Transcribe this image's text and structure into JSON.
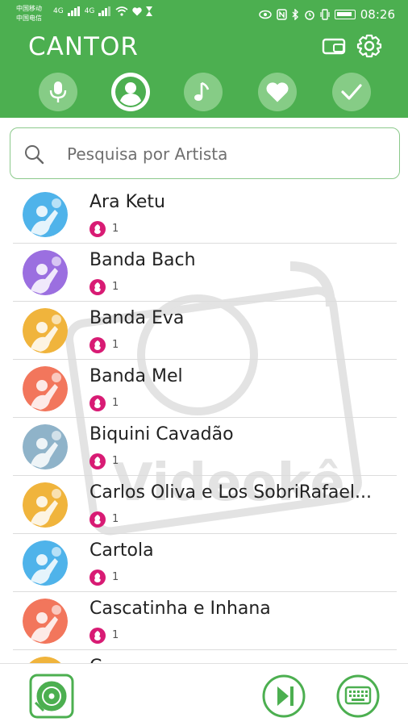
{
  "status_bar": {
    "carrier_1": "中国移动",
    "carrier_2": "中国电信",
    "network_1": "4G",
    "network_2": "4G",
    "time": "08:26"
  },
  "header": {
    "title": "CANTOR"
  },
  "tabs": [
    {
      "name": "microphone",
      "active": false
    },
    {
      "name": "artist",
      "active": true
    },
    {
      "name": "music",
      "active": false
    },
    {
      "name": "favorites",
      "active": false
    },
    {
      "name": "done",
      "active": false
    }
  ],
  "search": {
    "placeholder": "Pesquisa por Artista",
    "value": ""
  },
  "artists": [
    {
      "name": "Ara Ketu",
      "count": "1",
      "color": "#4fb3ea"
    },
    {
      "name": "Banda Bach",
      "count": "1",
      "color": "#9b6fe0"
    },
    {
      "name": "Banda Eva",
      "count": "1",
      "color": "#f0b43c"
    },
    {
      "name": "Banda Mel",
      "count": "1",
      "color": "#f2765c"
    },
    {
      "name": "Biquini Cavadão",
      "count": "1",
      "color": "#8fb3c9"
    },
    {
      "name": "Carlos Oliva e Los SobriRafael...",
      "count": "1",
      "color": "#f0b43c"
    },
    {
      "name": "Cartola",
      "count": "1",
      "color": "#4fb3ea"
    },
    {
      "name": "Cascatinha e Inhana",
      "count": "1",
      "color": "#f2765c"
    },
    {
      "name": "C...",
      "count": "",
      "color": "#f0b43c"
    }
  ],
  "colors": {
    "primary": "#4caf50",
    "badge": "#d81b74"
  }
}
